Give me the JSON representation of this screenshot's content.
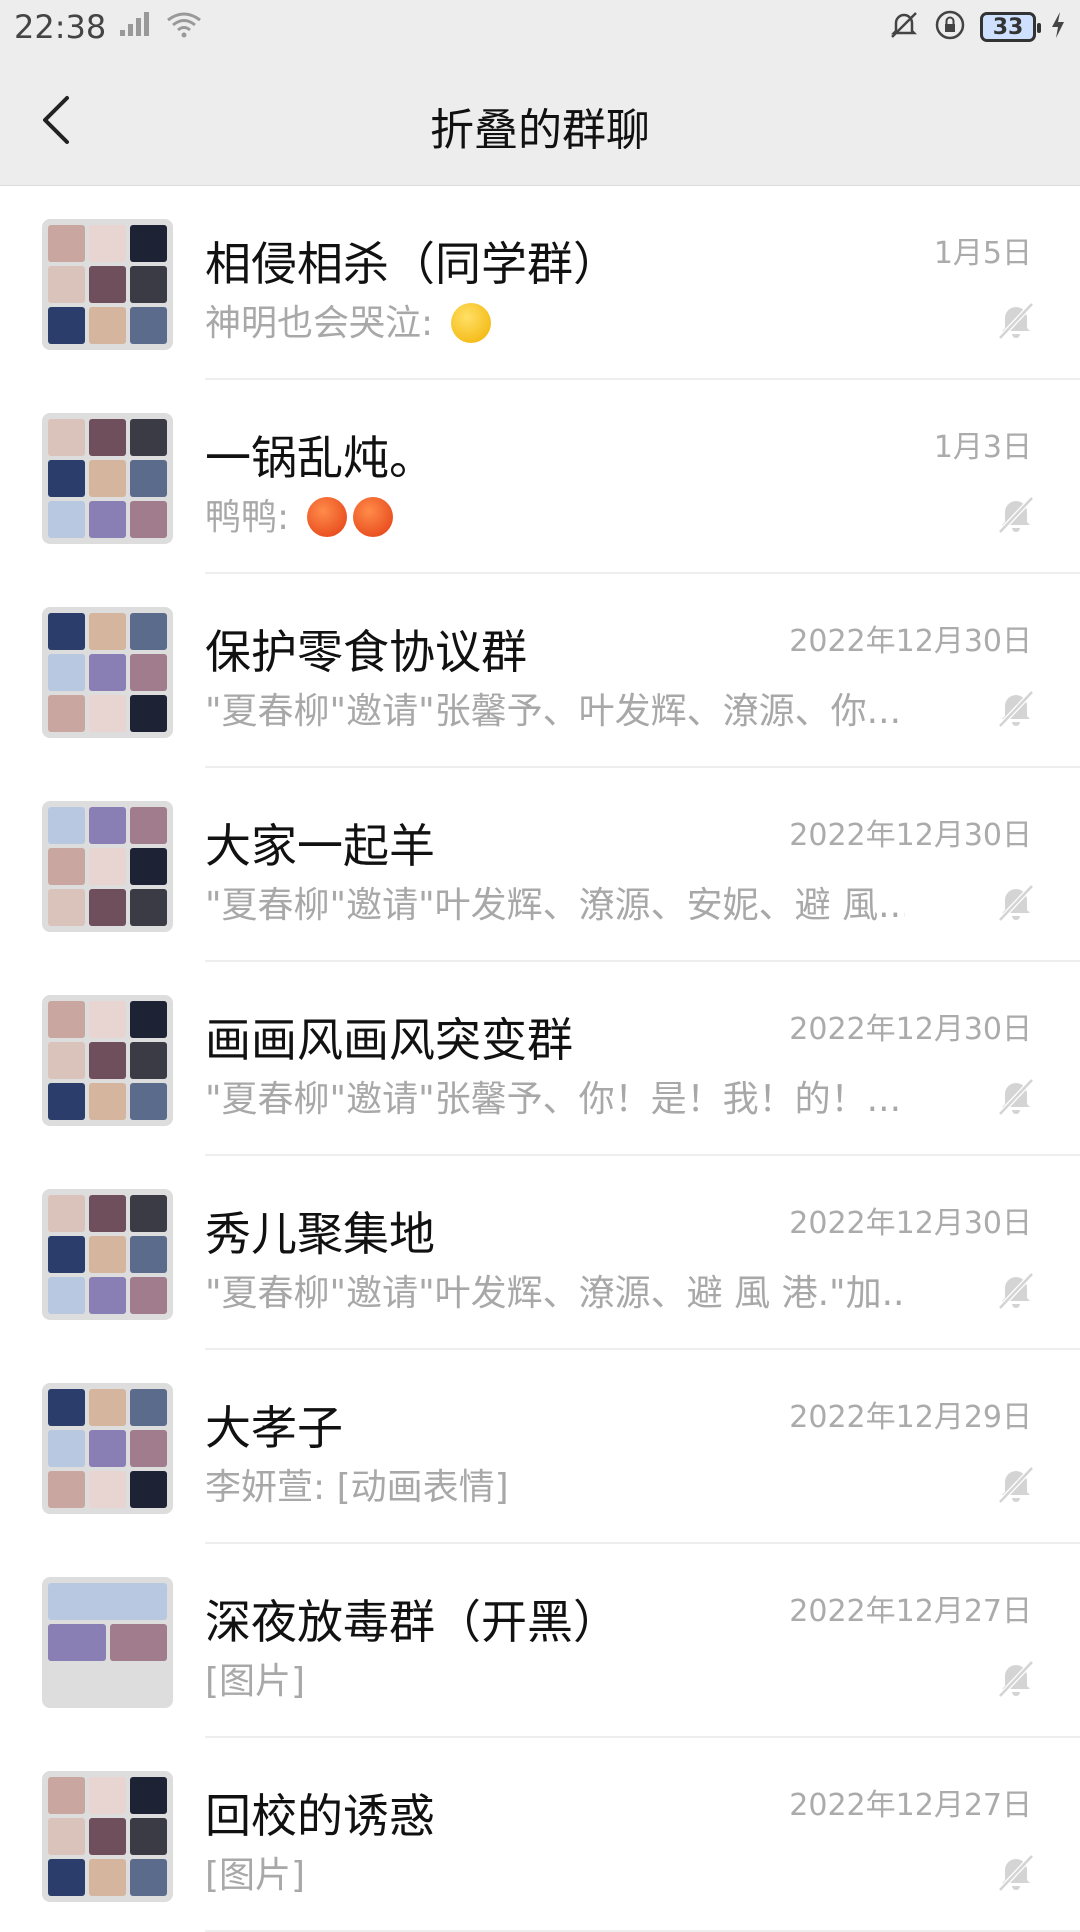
{
  "status": {
    "time": "22:38",
    "battery": "33"
  },
  "header": {
    "title": "折叠的群聊"
  },
  "chats": [
    {
      "name": "相侵相杀（同学群）",
      "preview": "神明也会哭泣: ",
      "emoji": "sleep",
      "time": "1月5日",
      "tiles": 9
    },
    {
      "name": "一锅乱炖。",
      "preview": "鸭鸭: ",
      "emoji": "angry-angry",
      "time": "1月3日",
      "tiles": 9
    },
    {
      "name": "保护零食协议群",
      "preview": "\"夏春柳\"邀请\"张馨予、叶发辉、潦源、你...",
      "emoji": "",
      "time": "2022年12月30日",
      "tiles": 9
    },
    {
      "name": "大家一起羊",
      "preview": "\"夏春柳\"邀请\"叶发辉、潦源、安妮、避 風...",
      "emoji": "",
      "time": "2022年12月30日",
      "tiles": 9
    },
    {
      "name": "画画风画风突变群",
      "preview": "\"夏春柳\"邀请\"张馨予、你！是！我！的！...",
      "emoji": "",
      "time": "2022年12月30日",
      "tiles": 9
    },
    {
      "name": "秀儿聚集地",
      "preview": "\"夏春柳\"邀请\"叶发辉、潦源、避 風 港.\"加...",
      "emoji": "",
      "time": "2022年12月30日",
      "tiles": 9
    },
    {
      "name": "大孝子",
      "preview": "李妍萱: [动画表情]",
      "emoji": "",
      "time": "2022年12月29日",
      "tiles": 9
    },
    {
      "name": "深夜放毒群（开黑）",
      "preview": "[图片]",
      "emoji": "",
      "time": "2022年12月27日",
      "tiles": 3
    },
    {
      "name": "回校的诱惑",
      "preview": "[图片]",
      "emoji": "",
      "time": "2022年12月27日",
      "tiles": 7
    }
  ],
  "colors": {
    "header_bg": "#ededed",
    "name": "#111111",
    "secondary": "#a8a8a8"
  },
  "icons": {
    "back": "chevron-left-icon",
    "mute": "bell-off-icon"
  }
}
